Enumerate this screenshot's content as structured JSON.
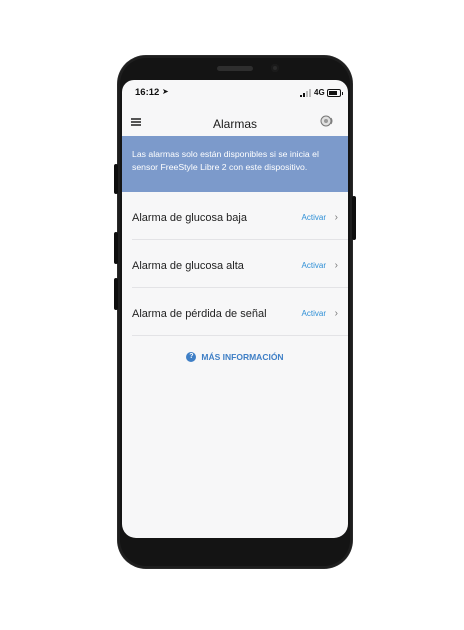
{
  "status": {
    "time": "16:12",
    "network": "4G"
  },
  "header": {
    "title": "Alarmas"
  },
  "banner": {
    "text": "Las alarmas solo están disponibles si se inicia el sensor FreeStyle Libre 2 con este dispositivo."
  },
  "alarms": [
    {
      "label": "Alarma de glucosa baja",
      "action": "Activar"
    },
    {
      "label": "Alarma de glucosa alta",
      "action": "Activar"
    },
    {
      "label": "Alarma de pérdida de señal",
      "action": "Activar"
    }
  ],
  "more_info": {
    "label": "MÁS INFORMACIÓN"
  },
  "colors": {
    "banner": "#7c9acb",
    "link": "#2e8fd6",
    "accent": "#3f7fc6"
  },
  "icons": [
    "menu-icon",
    "sensor-icon",
    "chevron-right-icon",
    "question-icon",
    "location-icon",
    "signal-icon",
    "battery-icon"
  ]
}
